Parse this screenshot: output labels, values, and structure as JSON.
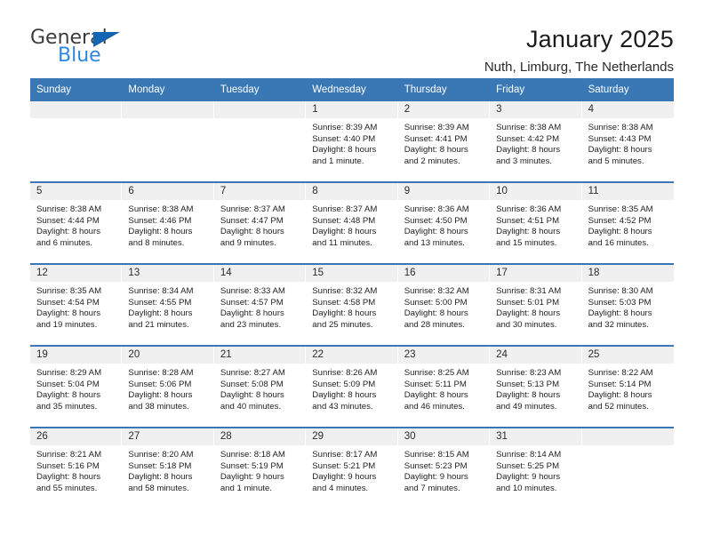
{
  "brand": {
    "name_part1": "General",
    "name_part2": "Blue",
    "logo_icon": "triangle-logo-icon"
  },
  "header": {
    "title": "January 2025",
    "subtitle": "Nuth, Limburg, The Netherlands"
  },
  "weekdays": [
    "Sunday",
    "Monday",
    "Tuesday",
    "Wednesday",
    "Thursday",
    "Friday",
    "Saturday"
  ],
  "colors": {
    "header_blue": "#3a78b5",
    "day_band_gray": "#f0f0f0",
    "brand_blue": "#2f87dd",
    "logo_triangle_blue": "#1464b4",
    "text_dark": "#1f1f1f"
  },
  "weeks": [
    [
      {
        "empty": true,
        "day": ""
      },
      {
        "empty": true,
        "day": ""
      },
      {
        "empty": true,
        "day": ""
      },
      {
        "empty": false,
        "day": "1",
        "sunrise": "Sunrise: 8:39 AM",
        "sunset": "Sunset: 4:40 PM",
        "daylight_line1": "Daylight: 8 hours",
        "daylight_line2": "and 1 minute."
      },
      {
        "empty": false,
        "day": "2",
        "sunrise": "Sunrise: 8:39 AM",
        "sunset": "Sunset: 4:41 PM",
        "daylight_line1": "Daylight: 8 hours",
        "daylight_line2": "and 2 minutes."
      },
      {
        "empty": false,
        "day": "3",
        "sunrise": "Sunrise: 8:38 AM",
        "sunset": "Sunset: 4:42 PM",
        "daylight_line1": "Daylight: 8 hours",
        "daylight_line2": "and 3 minutes."
      },
      {
        "empty": false,
        "day": "4",
        "sunrise": "Sunrise: 8:38 AM",
        "sunset": "Sunset: 4:43 PM",
        "daylight_line1": "Daylight: 8 hours",
        "daylight_line2": "and 5 minutes."
      }
    ],
    [
      {
        "empty": false,
        "day": "5",
        "sunrise": "Sunrise: 8:38 AM",
        "sunset": "Sunset: 4:44 PM",
        "daylight_line1": "Daylight: 8 hours",
        "daylight_line2": "and 6 minutes."
      },
      {
        "empty": false,
        "day": "6",
        "sunrise": "Sunrise: 8:38 AM",
        "sunset": "Sunset: 4:46 PM",
        "daylight_line1": "Daylight: 8 hours",
        "daylight_line2": "and 8 minutes."
      },
      {
        "empty": false,
        "day": "7",
        "sunrise": "Sunrise: 8:37 AM",
        "sunset": "Sunset: 4:47 PM",
        "daylight_line1": "Daylight: 8 hours",
        "daylight_line2": "and 9 minutes."
      },
      {
        "empty": false,
        "day": "8",
        "sunrise": "Sunrise: 8:37 AM",
        "sunset": "Sunset: 4:48 PM",
        "daylight_line1": "Daylight: 8 hours",
        "daylight_line2": "and 11 minutes."
      },
      {
        "empty": false,
        "day": "9",
        "sunrise": "Sunrise: 8:36 AM",
        "sunset": "Sunset: 4:50 PM",
        "daylight_line1": "Daylight: 8 hours",
        "daylight_line2": "and 13 minutes."
      },
      {
        "empty": false,
        "day": "10",
        "sunrise": "Sunrise: 8:36 AM",
        "sunset": "Sunset: 4:51 PM",
        "daylight_line1": "Daylight: 8 hours",
        "daylight_line2": "and 15 minutes."
      },
      {
        "empty": false,
        "day": "11",
        "sunrise": "Sunrise: 8:35 AM",
        "sunset": "Sunset: 4:52 PM",
        "daylight_line1": "Daylight: 8 hours",
        "daylight_line2": "and 16 minutes."
      }
    ],
    [
      {
        "empty": false,
        "day": "12",
        "sunrise": "Sunrise: 8:35 AM",
        "sunset": "Sunset: 4:54 PM",
        "daylight_line1": "Daylight: 8 hours",
        "daylight_line2": "and 19 minutes."
      },
      {
        "empty": false,
        "day": "13",
        "sunrise": "Sunrise: 8:34 AM",
        "sunset": "Sunset: 4:55 PM",
        "daylight_line1": "Daylight: 8 hours",
        "daylight_line2": "and 21 minutes."
      },
      {
        "empty": false,
        "day": "14",
        "sunrise": "Sunrise: 8:33 AM",
        "sunset": "Sunset: 4:57 PM",
        "daylight_line1": "Daylight: 8 hours",
        "daylight_line2": "and 23 minutes."
      },
      {
        "empty": false,
        "day": "15",
        "sunrise": "Sunrise: 8:32 AM",
        "sunset": "Sunset: 4:58 PM",
        "daylight_line1": "Daylight: 8 hours",
        "daylight_line2": "and 25 minutes."
      },
      {
        "empty": false,
        "day": "16",
        "sunrise": "Sunrise: 8:32 AM",
        "sunset": "Sunset: 5:00 PM",
        "daylight_line1": "Daylight: 8 hours",
        "daylight_line2": "and 28 minutes."
      },
      {
        "empty": false,
        "day": "17",
        "sunrise": "Sunrise: 8:31 AM",
        "sunset": "Sunset: 5:01 PM",
        "daylight_line1": "Daylight: 8 hours",
        "daylight_line2": "and 30 minutes."
      },
      {
        "empty": false,
        "day": "18",
        "sunrise": "Sunrise: 8:30 AM",
        "sunset": "Sunset: 5:03 PM",
        "daylight_line1": "Daylight: 8 hours",
        "daylight_line2": "and 32 minutes."
      }
    ],
    [
      {
        "empty": false,
        "day": "19",
        "sunrise": "Sunrise: 8:29 AM",
        "sunset": "Sunset: 5:04 PM",
        "daylight_line1": "Daylight: 8 hours",
        "daylight_line2": "and 35 minutes."
      },
      {
        "empty": false,
        "day": "20",
        "sunrise": "Sunrise: 8:28 AM",
        "sunset": "Sunset: 5:06 PM",
        "daylight_line1": "Daylight: 8 hours",
        "daylight_line2": "and 38 minutes."
      },
      {
        "empty": false,
        "day": "21",
        "sunrise": "Sunrise: 8:27 AM",
        "sunset": "Sunset: 5:08 PM",
        "daylight_line1": "Daylight: 8 hours",
        "daylight_line2": "and 40 minutes."
      },
      {
        "empty": false,
        "day": "22",
        "sunrise": "Sunrise: 8:26 AM",
        "sunset": "Sunset: 5:09 PM",
        "daylight_line1": "Daylight: 8 hours",
        "daylight_line2": "and 43 minutes."
      },
      {
        "empty": false,
        "day": "23",
        "sunrise": "Sunrise: 8:25 AM",
        "sunset": "Sunset: 5:11 PM",
        "daylight_line1": "Daylight: 8 hours",
        "daylight_line2": "and 46 minutes."
      },
      {
        "empty": false,
        "day": "24",
        "sunrise": "Sunrise: 8:23 AM",
        "sunset": "Sunset: 5:13 PM",
        "daylight_line1": "Daylight: 8 hours",
        "daylight_line2": "and 49 minutes."
      },
      {
        "empty": false,
        "day": "25",
        "sunrise": "Sunrise: 8:22 AM",
        "sunset": "Sunset: 5:14 PM",
        "daylight_line1": "Daylight: 8 hours",
        "daylight_line2": "and 52 minutes."
      }
    ],
    [
      {
        "empty": false,
        "day": "26",
        "sunrise": "Sunrise: 8:21 AM",
        "sunset": "Sunset: 5:16 PM",
        "daylight_line1": "Daylight: 8 hours",
        "daylight_line2": "and 55 minutes."
      },
      {
        "empty": false,
        "day": "27",
        "sunrise": "Sunrise: 8:20 AM",
        "sunset": "Sunset: 5:18 PM",
        "daylight_line1": "Daylight: 8 hours",
        "daylight_line2": "and 58 minutes."
      },
      {
        "empty": false,
        "day": "28",
        "sunrise": "Sunrise: 8:18 AM",
        "sunset": "Sunset: 5:19 PM",
        "daylight_line1": "Daylight: 9 hours",
        "daylight_line2": "and 1 minute."
      },
      {
        "empty": false,
        "day": "29",
        "sunrise": "Sunrise: 8:17 AM",
        "sunset": "Sunset: 5:21 PM",
        "daylight_line1": "Daylight: 9 hours",
        "daylight_line2": "and 4 minutes."
      },
      {
        "empty": false,
        "day": "30",
        "sunrise": "Sunrise: 8:15 AM",
        "sunset": "Sunset: 5:23 PM",
        "daylight_line1": "Daylight: 9 hours",
        "daylight_line2": "and 7 minutes."
      },
      {
        "empty": false,
        "day": "31",
        "sunrise": "Sunrise: 8:14 AM",
        "sunset": "Sunset: 5:25 PM",
        "daylight_line1": "Daylight: 9 hours",
        "daylight_line2": "and 10 minutes."
      },
      {
        "empty": true,
        "day": ""
      }
    ]
  ]
}
